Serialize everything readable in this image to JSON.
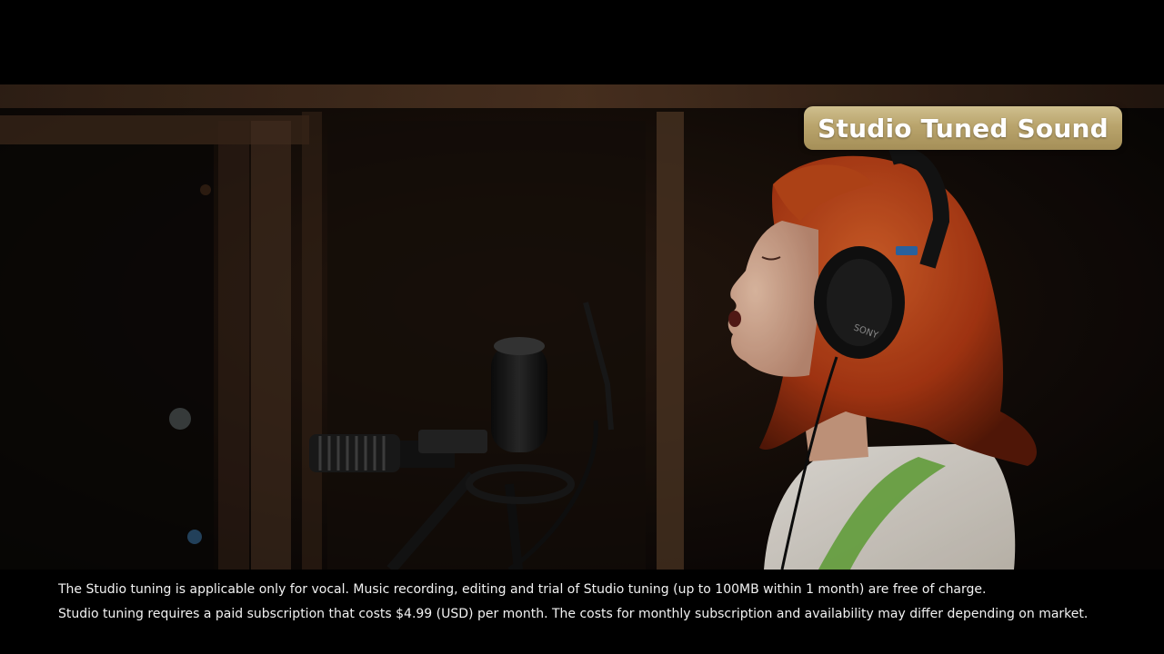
{
  "badge": {
    "label": "Studio Tuned Sound"
  },
  "caption": {
    "line1": "The Studio tuning is applicable only for vocal. Music recording, editing and trial of Studio tuning (up to 100MB within 1 month) are free of charge.",
    "line2": "Studio tuning requires a paid subscription that costs $4.99 (USD) per month. The costs for monthly subscription and availability may differ depending on market."
  },
  "scene": {
    "headphones_brand": "SONY"
  },
  "colors": {
    "badge_gold": "#b9a46c",
    "hair": "#c4461c",
    "sweater": "#e9e4dc",
    "overall_strap": "#6fb342",
    "background": "#0d0906"
  }
}
